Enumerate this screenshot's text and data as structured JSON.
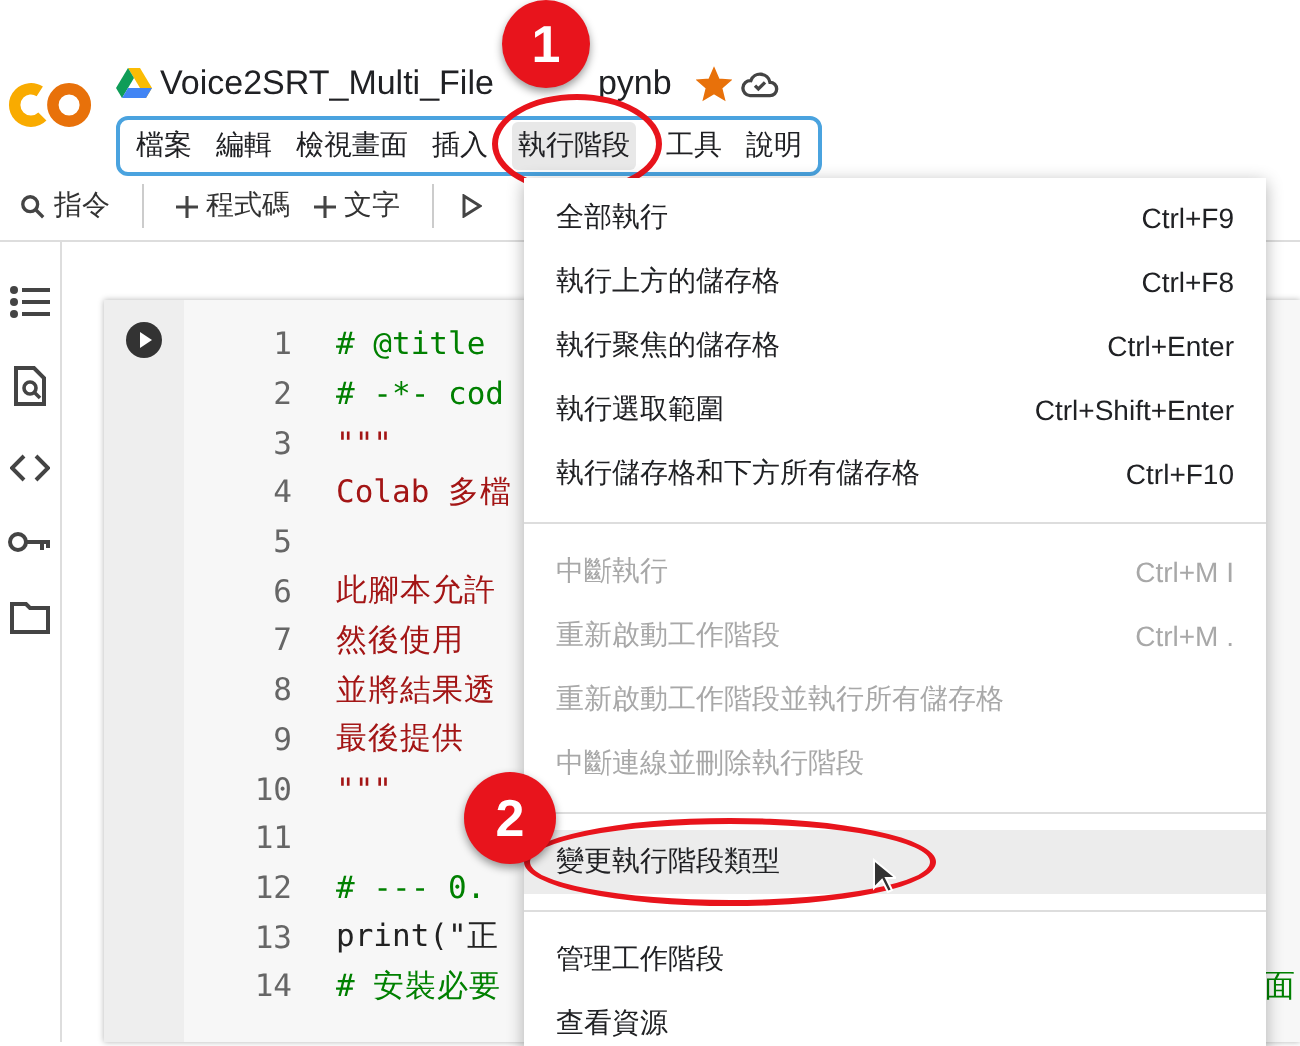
{
  "header": {
    "title_start": "Voice2SRT_Multi_File",
    "title_end": "pynb",
    "starred": true
  },
  "menubar": [
    {
      "label": "檔案",
      "selected": false
    },
    {
      "label": "編輯",
      "selected": false
    },
    {
      "label": "檢視畫面",
      "selected": false
    },
    {
      "label": "插入",
      "selected": false
    },
    {
      "label": "執行階段",
      "selected": true
    },
    {
      "label": "工具",
      "selected": false
    },
    {
      "label": "說明",
      "selected": false
    }
  ],
  "toolbar": [
    {
      "kind": "search",
      "label": "指令"
    },
    {
      "kind": "divider"
    },
    {
      "kind": "add",
      "label": "程式碼"
    },
    {
      "kind": "add",
      "label": "文字"
    },
    {
      "kind": "divider"
    },
    {
      "kind": "run"
    }
  ],
  "code": [
    {
      "no": "1",
      "text": "# @title",
      "kind": "comment"
    },
    {
      "no": "2",
      "text": "# -*- cod",
      "kind": "comment"
    },
    {
      "no": "3",
      "text": "\"\"\"",
      "kind": "string"
    },
    {
      "no": "4",
      "text": "Colab 多檔",
      "kind": "string"
    },
    {
      "no": "5"
    },
    {
      "no": "6",
      "text": "此腳本允許",
      "kind": "string"
    },
    {
      "no": "7",
      "text": "然後使用",
      "kind": "string"
    },
    {
      "no": "8",
      "text": "並將結果透",
      "kind": "string"
    },
    {
      "no": "9",
      "text": "最後提供",
      "kind": "string"
    },
    {
      "no": "10",
      "text": "\"\"\"",
      "kind": "string"
    },
    {
      "no": "11"
    },
    {
      "no": "12",
      "text": "# --- 0.",
      "kind": "comment"
    },
    {
      "no": "13",
      "text": "print(\"正",
      "kind": "plain"
    },
    {
      "no": "14",
      "text": "# 安裝必要",
      "kind": "comment",
      "tail": "面"
    }
  ],
  "menu": [
    {
      "kind": "item",
      "label": "全部執行",
      "shortcut": "Ctrl+F9",
      "disabled": false,
      "selected": false
    },
    {
      "kind": "item",
      "label": "執行上方的儲存格",
      "shortcut": "Ctrl+F8",
      "disabled": false,
      "selected": false
    },
    {
      "kind": "item",
      "label": "執行聚焦的儲存格",
      "shortcut": "Ctrl+Enter",
      "disabled": false,
      "selected": false
    },
    {
      "kind": "item",
      "label": "執行選取範圍",
      "shortcut": "Ctrl+Shift+Enter",
      "disabled": false,
      "selected": false
    },
    {
      "kind": "item",
      "label": "執行儲存格和下方所有儲存格",
      "shortcut": "Ctrl+F10",
      "disabled": false,
      "selected": false
    },
    {
      "kind": "separator"
    },
    {
      "kind": "item",
      "label": "中斷執行",
      "shortcut": "Ctrl+M I",
      "disabled": true,
      "selected": false
    },
    {
      "kind": "item",
      "label": "重新啟動工作階段",
      "shortcut": "Ctrl+M .",
      "disabled": true,
      "selected": false
    },
    {
      "kind": "item",
      "label": "重新啟動工作階段並執行所有儲存格",
      "disabled": true,
      "selected": false
    },
    {
      "kind": "item",
      "label": "中斷連線並刪除執行階段",
      "disabled": true,
      "selected": false
    },
    {
      "kind": "separator"
    },
    {
      "kind": "item",
      "label": "變更執行階段類型",
      "disabled": false,
      "selected": true
    },
    {
      "kind": "separator"
    },
    {
      "kind": "item",
      "label": "管理工作階段",
      "disabled": false,
      "selected": false
    },
    {
      "kind": "item",
      "label": "查看資源",
      "disabled": false,
      "selected": false
    }
  ],
  "annotations": [
    {
      "label": "1"
    },
    {
      "label": "2"
    }
  ]
}
